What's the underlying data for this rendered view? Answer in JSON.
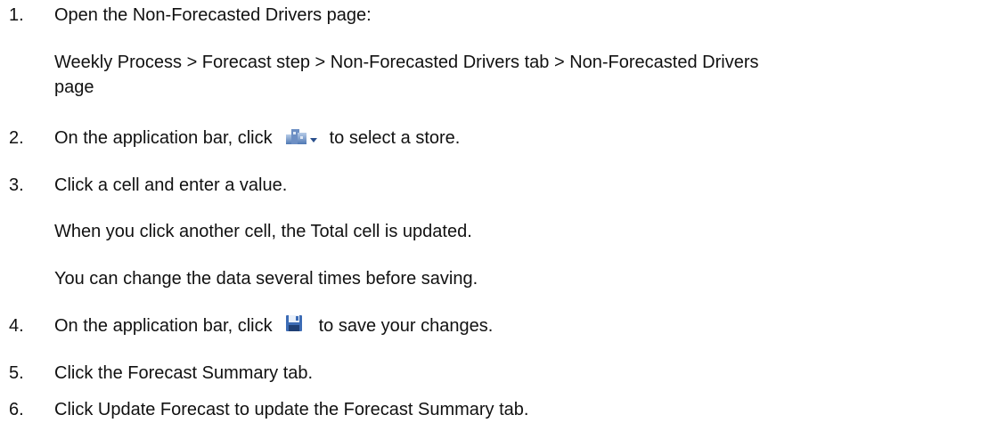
{
  "steps": [
    {
      "number": "1.",
      "text": "Open the Non-Forecasted Drivers page:",
      "path_line1": "Weekly Process > Forecast step > Non-Forecasted Drivers tab > Non-Forecasted Drivers",
      "path_line2": "page"
    },
    {
      "number": "2.",
      "text_before": "On the application bar, click",
      "icon": "store-selector-icon",
      "text_after": "to select a store."
    },
    {
      "number": "3.",
      "text": "Click a cell and enter a value.",
      "note1": "When you click another cell, the Total cell is updated.",
      "note2": "You can change the data several times before saving."
    },
    {
      "number": "4.",
      "text_before": "On the application bar, click",
      "icon": "save-icon",
      "text_after": "to save your changes."
    },
    {
      "number": "5.",
      "text": "Click the Forecast Summary tab."
    },
    {
      "number": "6.",
      "text": "Click Update Forecast to update the Forecast Summary tab."
    }
  ]
}
